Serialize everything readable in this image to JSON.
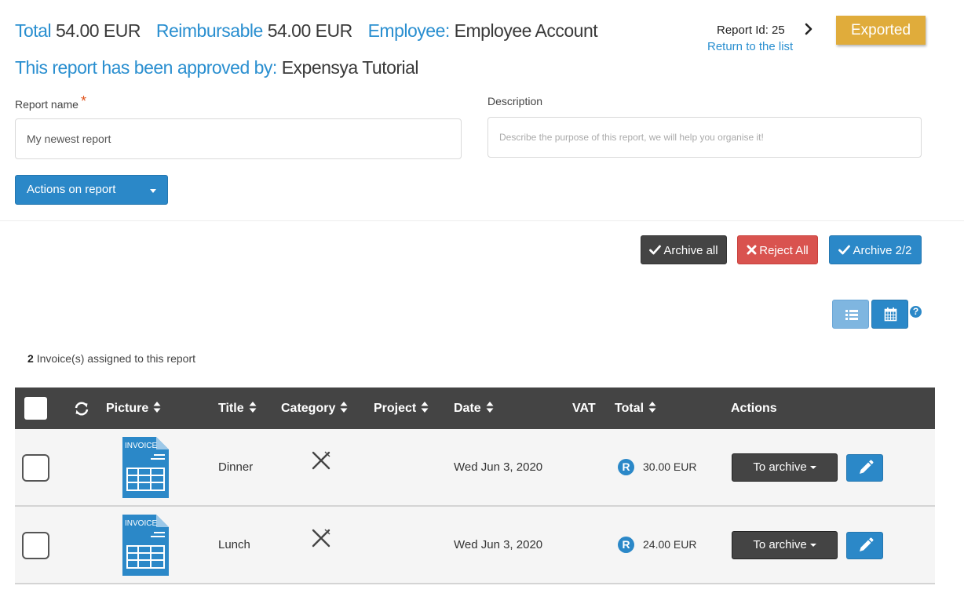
{
  "summary": {
    "total_label": "Total",
    "total_value": "54.00 EUR",
    "reimbursable_label": "Reimbursable",
    "reimbursable_value": "54.00 EUR",
    "employee_label": "Employee:",
    "employee_value": "Employee Account",
    "approved_label": "This report has been approved by:",
    "approved_value": "Expensya Tutorial"
  },
  "header": {
    "report_id": "Report Id: 25",
    "return_link": "Return to the list",
    "status_button": "Exported"
  },
  "form": {
    "report_name_label": "Report name",
    "required_mark": "*",
    "report_name_value": "My newest report",
    "description_label": "Description",
    "description_placeholder": "Describe the purpose of this report, we will help you organise it!",
    "actions_button": "Actions on report"
  },
  "bulk_actions": {
    "archive_all": "Archive all",
    "reject_all": "Reject All",
    "archive_count": "Archive 2/2"
  },
  "view": {
    "help": "?"
  },
  "invoices": {
    "count": "2",
    "count_suffix": "Invoice(s) assigned to this report"
  },
  "table": {
    "columns": {
      "picture": "Picture",
      "title": "Title",
      "category": "Category",
      "project": "Project",
      "date": "Date",
      "vat": "VAT",
      "total": "Total",
      "actions": "Actions"
    },
    "rows": [
      {
        "invoice_label": "INVOICE",
        "title": "Dinner",
        "category_icon": "fork-knife-icon",
        "date": "Wed Jun 3, 2020",
        "reimbursable_badge": "R",
        "total": "30.00 EUR",
        "action": "To archive"
      },
      {
        "invoice_label": "INVOICE",
        "title": "Lunch",
        "category_icon": "fork-knife-icon",
        "date": "Wed Jun 3, 2020",
        "reimbursable_badge": "R",
        "total": "24.00 EUR",
        "action": "To archive"
      }
    ]
  },
  "colors": {
    "accent_blue": "#2b88c8",
    "exported_gold": "#e0ac3b",
    "reject_red": "#d9534f",
    "dark": "#444444"
  }
}
